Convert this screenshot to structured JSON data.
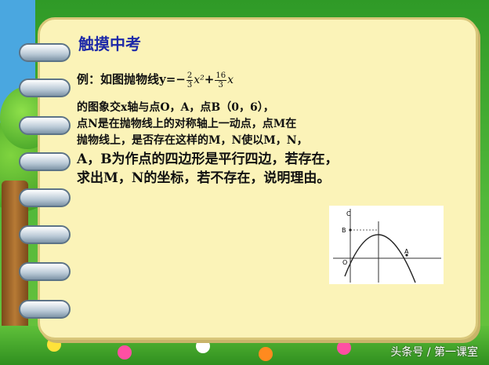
{
  "slide": {
    "title": "触摸中考",
    "example_prefix": "例：如图抛物线y=−",
    "coef1_num": "2",
    "coef1_den": "3",
    "x2": "x²",
    "plus": "+",
    "coef2_num": "16",
    "coef2_den": "3",
    "x": "x",
    "lines": [
      "的图象交x轴与点O，A，点B（0，6），",
      "点N是在抛物线上的对称轴上一动点，点M在",
      "抛物线上，是否存在这样的M，N使以M，N，",
      "A，B为作点的四边形是平行四边，若存在，",
      "求出M，N的坐标，若不存在，说明理由。"
    ]
  },
  "graph": {
    "label_c": "C",
    "label_b": "B",
    "label_o": "O",
    "label_a": "A"
  },
  "footer": {
    "watermark": "头条号 / 第一课室"
  }
}
